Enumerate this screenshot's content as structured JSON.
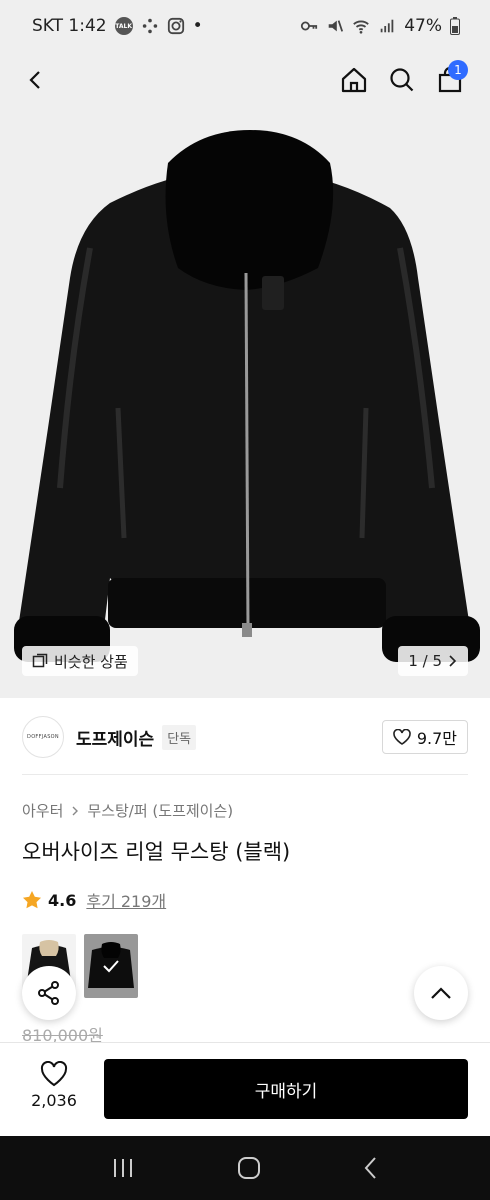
{
  "status_bar": {
    "carrier_time": "SKT 1:42",
    "talk_badge": "TALK",
    "dot": "•",
    "battery": "47%"
  },
  "nav": {
    "cart_count": "1",
    "icons": [
      "back-icon",
      "home-icon",
      "search-icon",
      "shopping-bag-icon"
    ]
  },
  "hero": {
    "similar_label": "비슷한 상품",
    "page_indicator": "1 / 5"
  },
  "brand": {
    "logo_text": "DOFFJASON",
    "name": "도프제이슨",
    "tag": "단독",
    "likes": "9.7만"
  },
  "product": {
    "breadcrumb": [
      "아우터",
      "무스탕/퍼 (도프제이슨)"
    ],
    "title": "오버사이즈 리얼 무스탕 (블랙)",
    "rating": "4.6",
    "reviews": "후기 219개",
    "original_price": "810,000원"
  },
  "bottom_bar": {
    "wish_count": "2,036",
    "buy_label": "구매하기"
  },
  "colors": {
    "accent": "#2f6bff",
    "star": "#f5a623",
    "buy_button": "#000000"
  }
}
